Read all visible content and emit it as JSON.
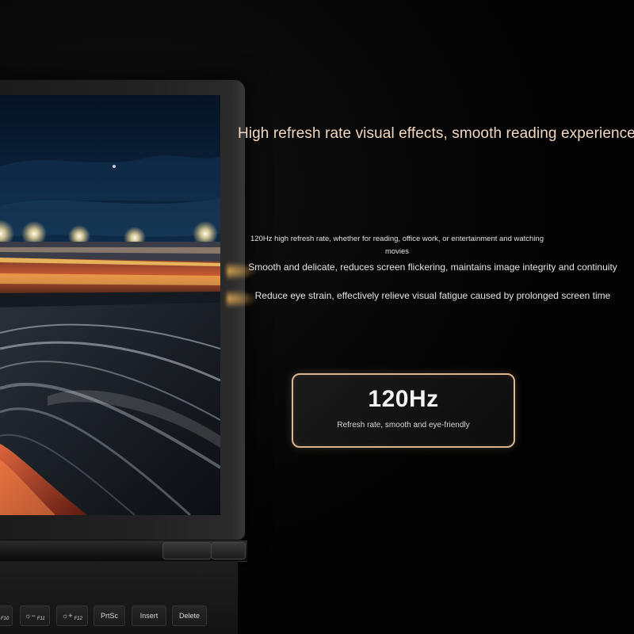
{
  "headline": "High refresh rate visual effects, smooth reading experience",
  "description": {
    "small": "120Hz high refresh rate, whether for reading, office work, or entertainment and watching movies",
    "line2": "Smooth and delicate, reduces screen flickering, maintains image integrity and continuity",
    "line3": "Reduce eye strain, effectively relieve visual fatigue caused by prolonged screen time"
  },
  "badge": {
    "value": "120Hz",
    "caption": "Refresh rate, smooth and eye-friendly"
  },
  "keyboard": {
    "keys": [
      {
        "glyph": "",
        "label": "F10"
      },
      {
        "glyph": "☼−",
        "label": "F11"
      },
      {
        "glyph": "☼+",
        "label": "F12"
      },
      {
        "glyph": "",
        "label": "PrtSc"
      },
      {
        "glyph": "",
        "label": "Insert"
      },
      {
        "glyph": "",
        "label": "Delete"
      }
    ]
  },
  "colors": {
    "background": "#030303",
    "headline": "#f1d7c2",
    "badge_border": "#d9b48f",
    "accent_light": "#ffbe5a"
  },
  "icons": {
    "brightness_down": "brightness-down-icon",
    "brightness_up": "brightness-up-icon"
  }
}
